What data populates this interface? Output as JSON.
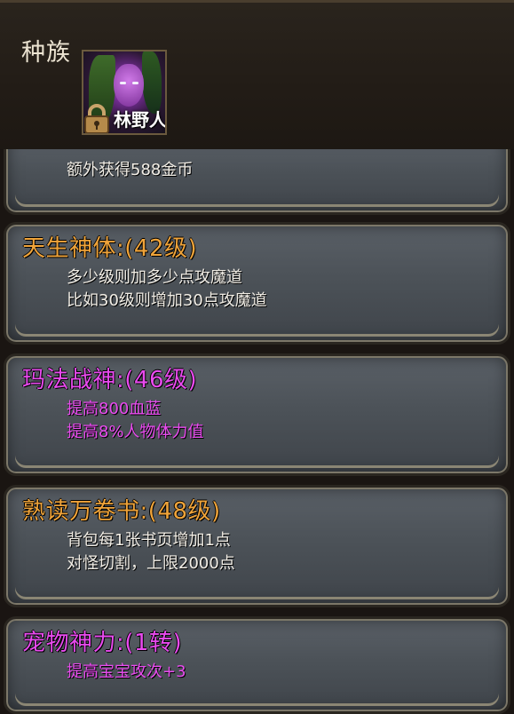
{
  "header": {
    "title": "种族",
    "avatar": {
      "label": "林野人",
      "locked": true,
      "icon": "lock-icon"
    }
  },
  "colors": {
    "orange": "#f0a43a",
    "violet": "#e94bef",
    "white": "#f2eee6"
  },
  "panels": [
    {
      "title": "",
      "lines": [
        "额外获得588金币"
      ],
      "color": "white"
    },
    {
      "title": "天生神体:(42级)",
      "lines": [
        "多少级则加多少点攻魔道",
        "比如30级则增加30点攻魔道"
      ],
      "color": "orange"
    },
    {
      "title": "玛法战神:(46级)",
      "lines": [
        "提高800血蓝",
        "提高8%人物体力值"
      ],
      "color": "violet"
    },
    {
      "title": "熟读万卷书:(48级)",
      "lines": [
        "背包每1张书页增加1点",
        "对怪切割，上限2000点"
      ],
      "color": "orange"
    },
    {
      "title": "宠物神力:(1转)",
      "lines": [
        "提高宝宝攻次+3"
      ],
      "color": "violet"
    }
  ]
}
